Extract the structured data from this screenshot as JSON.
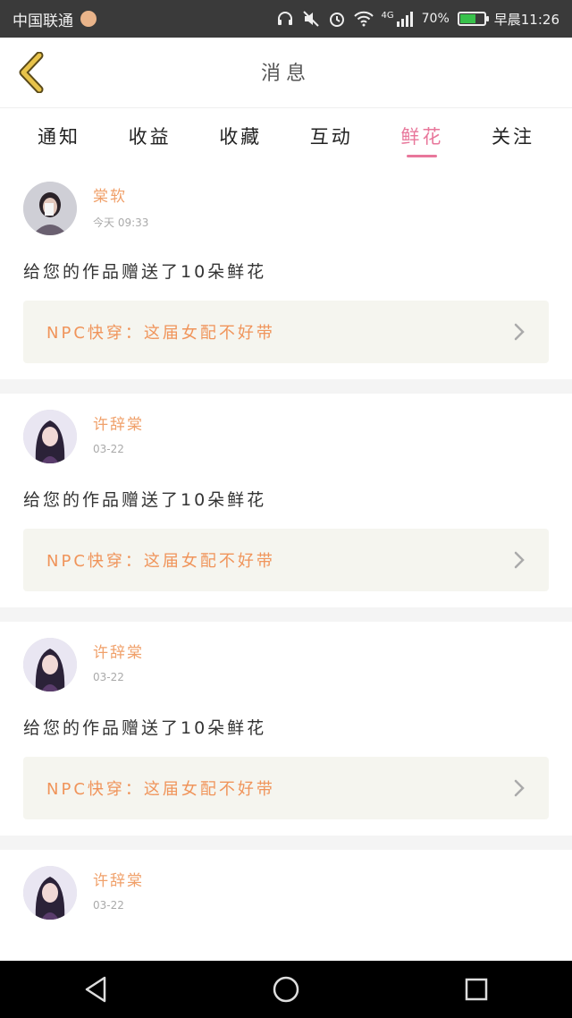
{
  "status_bar": {
    "carrier": "中国联通",
    "network": "4G",
    "battery_percent": "70%",
    "battery_level": 0.7,
    "time": "早晨11:26",
    "icons": [
      "headphones-icon",
      "mute-icon",
      "alarm-icon",
      "wifi-icon",
      "signal-icon",
      "battery-icon"
    ]
  },
  "header": {
    "back_icon": "chevron-left-icon",
    "title": "消息"
  },
  "tabs": [
    {
      "label": "通知",
      "active": false
    },
    {
      "label": "收益",
      "active": false
    },
    {
      "label": "收藏",
      "active": false
    },
    {
      "label": "互动",
      "active": false
    },
    {
      "label": "鲜花",
      "active": true
    },
    {
      "label": "关注",
      "active": false
    }
  ],
  "messages": [
    {
      "user": "棠软",
      "time": "今天 09:33",
      "text": "给您的作品赠送了10朵鲜花",
      "work_title": "NPC快穿：这届女配不好带"
    },
    {
      "user": "许辞棠",
      "time": "03-22",
      "text": "给您的作品赠送了10朵鲜花",
      "work_title": "NPC快穿：这届女配不好带"
    },
    {
      "user": "许辞棠",
      "time": "03-22",
      "text": "给您的作品赠送了10朵鲜花",
      "work_title": "NPC快穿：这届女配不好带"
    },
    {
      "user": "许辞棠",
      "time": "03-22",
      "text": "",
      "work_title": ""
    }
  ],
  "colors": {
    "accent": "#e8779b",
    "name": "#f0a06a",
    "link": "#f0945a",
    "back_icon": "#e8c34a"
  },
  "nav": {
    "icons": [
      "back-triangle-icon",
      "home-circle-icon",
      "recents-square-icon"
    ]
  }
}
